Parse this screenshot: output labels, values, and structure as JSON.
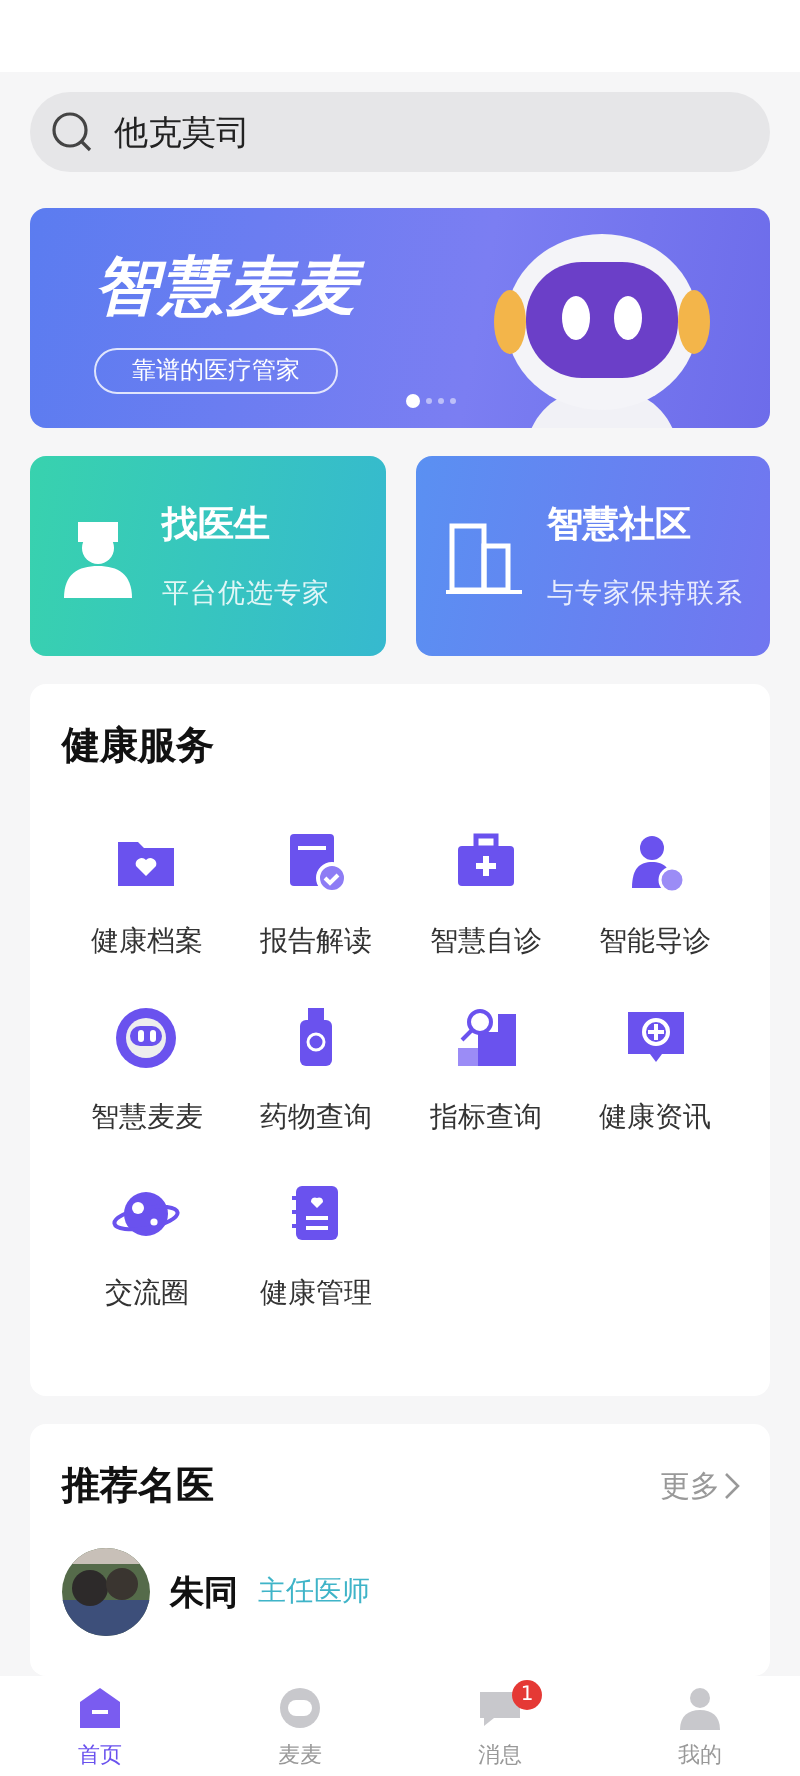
{
  "search": {
    "value": "他克莫司"
  },
  "banner": {
    "title": "智慧麦麦",
    "subtitle": "靠谱的医疗管家",
    "dots": [
      {
        "selected": true
      },
      {
        "selected": false
      },
      {
        "selected": false
      },
      {
        "selected": false
      }
    ]
  },
  "shortcuts": [
    {
      "title": "找医生",
      "subtitle": "平台优选专家",
      "kind": "doctor"
    },
    {
      "title": "智慧社区",
      "subtitle": "与专家保持联系",
      "kind": "community"
    }
  ],
  "services": {
    "title": "健康服务",
    "items": [
      "健康档案",
      "报告解读",
      "智慧自诊",
      "智能导诊",
      "智慧麦麦",
      "药物查询",
      "指标查询",
      "健康资讯",
      "交流圈",
      "健康管理"
    ]
  },
  "doctors": {
    "title": "推荐名医",
    "more": "更多",
    "rows": [
      {
        "name": "朱同",
        "title": "主任医师"
      }
    ]
  },
  "tabbar": [
    {
      "label": "首页",
      "selected": true
    },
    {
      "label": "麦麦",
      "selected": false
    },
    {
      "label": "消息",
      "selected": false,
      "badge": "1"
    },
    {
      "label": "我的",
      "selected": false
    }
  ]
}
